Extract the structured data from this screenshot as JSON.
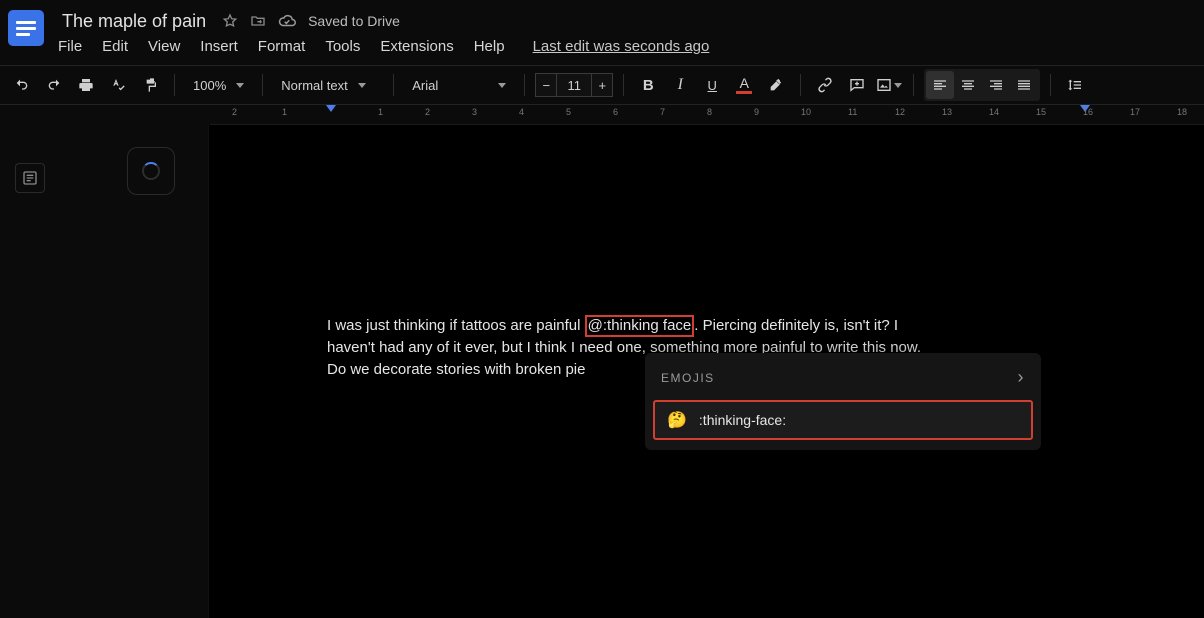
{
  "header": {
    "title": "The maple of pain",
    "saved_label": "Saved to Drive",
    "last_edit": "Last edit was seconds ago"
  },
  "menus": {
    "file": "File",
    "edit": "Edit",
    "view": "View",
    "insert": "Insert",
    "format": "Format",
    "tools": "Tools",
    "extensions": "Extensions",
    "help": "Help"
  },
  "toolbar": {
    "zoom": "100%",
    "style": "Normal text",
    "font": "Arial",
    "font_size": "11"
  },
  "ruler": {
    "labels": [
      "2",
      "1",
      "",
      "1",
      "2",
      "3",
      "4",
      "5",
      "6",
      "7",
      "8",
      "9",
      "10",
      "11",
      "12",
      "13",
      "14",
      "15",
      "16",
      "17",
      "18"
    ]
  },
  "document": {
    "line1a": "I was just thinking if tattoos are painful ",
    "mention": "@:thinking face",
    "line1b": ". Piercing definitely is, isn't it? I",
    "line2": "haven't had any of it ever, but I think I need one, something more painful to write this now.",
    "line3": "Do we decorate stories with broken pie"
  },
  "emoji_popup": {
    "heading": "EMOJIS",
    "item_glyph": "🤔",
    "item_code": ":thinking-face:"
  }
}
